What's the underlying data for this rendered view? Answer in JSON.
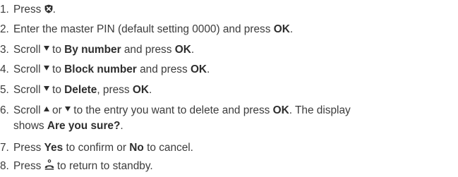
{
  "steps": [
    {
      "num": "1.",
      "press": "Press",
      "end": "."
    },
    {
      "num": "2.",
      "pre": "Enter the master PIN (default setting 0000) and press",
      "ok": "OK",
      "end": "."
    },
    {
      "num": "3.",
      "pre": "Scroll",
      "mid": "to",
      "target": "By number",
      "and_press": "and press",
      "ok": "OK",
      "end": "."
    },
    {
      "num": "4.",
      "pre": "Scroll",
      "mid": "to",
      "target": "Block number",
      "and_press": "and press",
      "ok": "OK",
      "end": "."
    },
    {
      "num": "5.",
      "pre": "Scroll",
      "mid": "to",
      "target": "Delete",
      "and_press": ", press",
      "ok": "OK",
      "end": "."
    },
    {
      "num": "6.",
      "pre": "Scroll",
      "or": "or",
      "mid": "to the entry you want to delete and press",
      "ok": "OK",
      "display": ". The display",
      "line2_pre": "shows",
      "target": "Are you sure?",
      "end": "."
    },
    {
      "num": "7.",
      "pre": "Press",
      "yes": "Yes",
      "mid": "to confirm or",
      "no": "No",
      "post": "to cancel."
    },
    {
      "num": "8.",
      "pre": "Press",
      "post": "to return to standby."
    }
  ],
  "icons": {
    "step1": "block-shield-icon",
    "scroll_down": "scroll-down-icon",
    "scroll_up": "scroll-up-icon",
    "step8": "handset-end-icon"
  }
}
